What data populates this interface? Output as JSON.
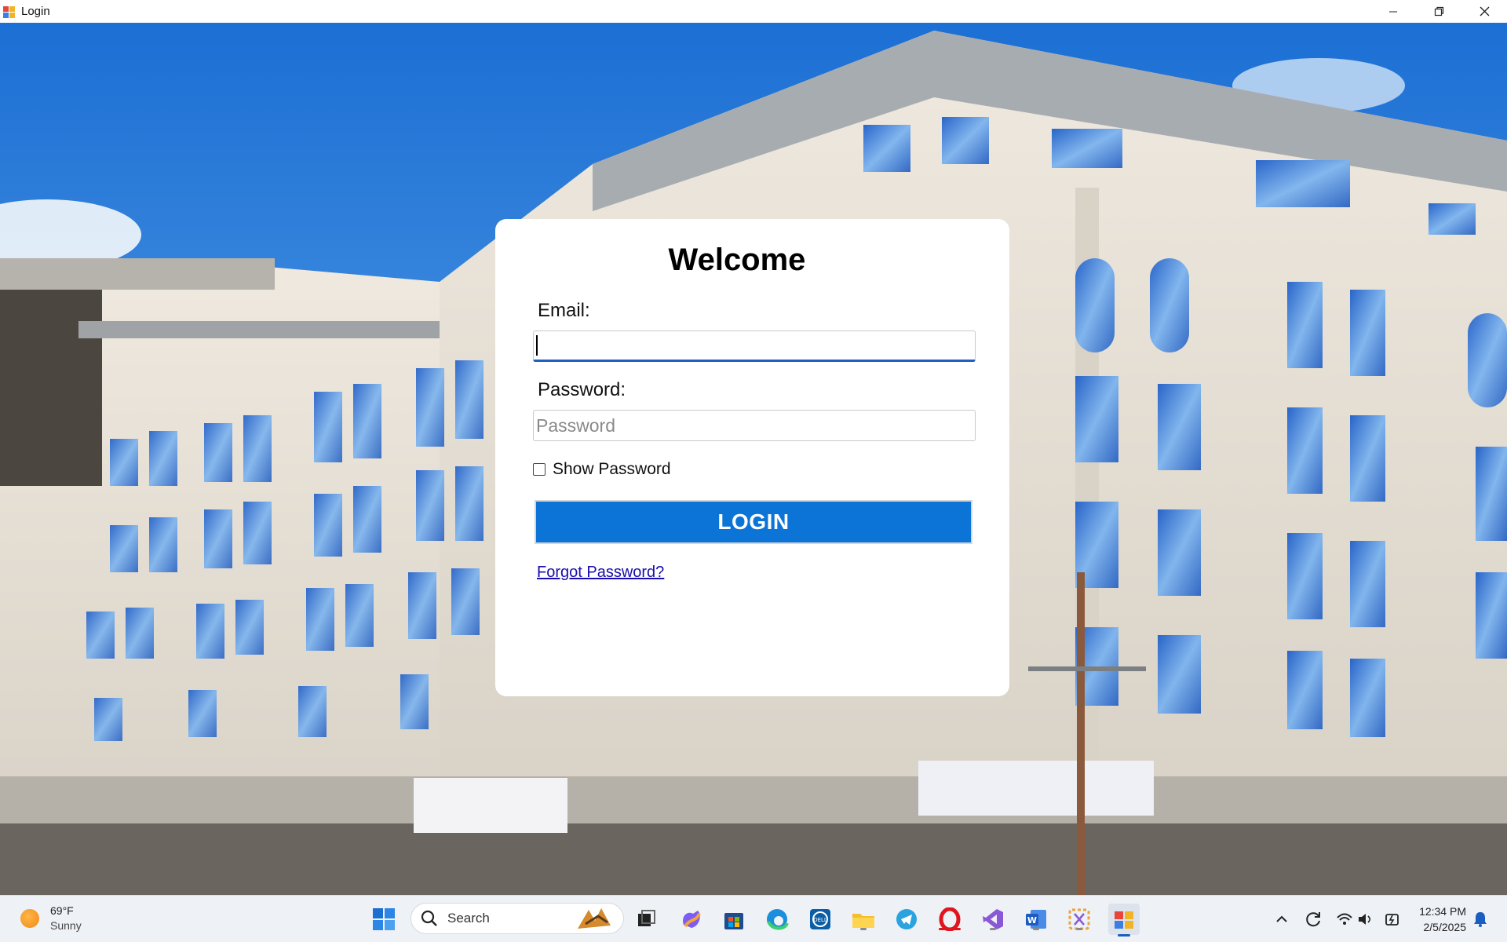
{
  "window": {
    "title": "Login",
    "controls": [
      "minimize",
      "restore",
      "close"
    ]
  },
  "login": {
    "title": "Welcome",
    "email_label": "Email:",
    "email_value": "",
    "password_label": "Password:",
    "password_placeholder": "Password",
    "show_password_label": "Show Password",
    "show_password_checked": false,
    "login_button": "LOGIN",
    "forgot_link": "Forgot Password?"
  },
  "colors": {
    "login_button": "#0b74d6",
    "link": "#1a0dab",
    "focus_underline": "#1e5fbf"
  },
  "taskbar": {
    "weather": {
      "temp": "69°F",
      "condition": "Sunny",
      "icon": "sun-icon"
    },
    "search_label": "Search",
    "pinned": [
      "windows-start-icon",
      "search-icon",
      "task-view-icon",
      "copilot-icon",
      "microsoft-store-icon",
      "edge-icon",
      "dell-icon",
      "file-explorer-icon",
      "telegram-icon",
      "opera-icon",
      "visual-studio-icon",
      "word-icon",
      "snipping-tool-icon",
      "login-app-icon"
    ],
    "tray": [
      "chevron-up-icon",
      "sync-icon",
      "wifi-icon",
      "volume-icon",
      "battery-icon",
      "notification-bell-icon"
    ],
    "time": "12:34 PM",
    "date": "2/5/2025"
  }
}
